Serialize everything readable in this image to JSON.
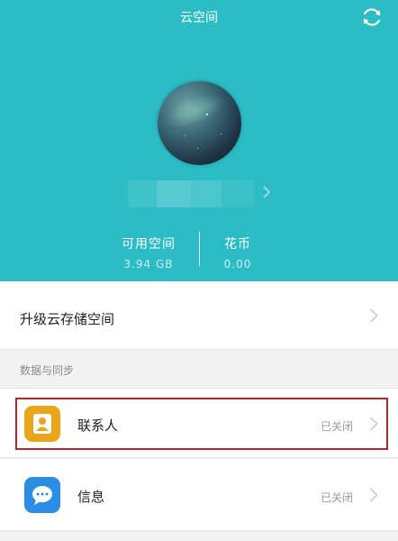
{
  "header": {
    "title": "云空间",
    "refresh_icon": "refresh-icon",
    "background_color": "#2bbcc5"
  },
  "account": {
    "avatar_icon": "avatar-image",
    "chevron_icon": "chevron-right-icon"
  },
  "stats": {
    "space_label": "可用空间",
    "space_value": "3.94 GB",
    "coins_label": "花币",
    "coins_value": "0.00"
  },
  "upgrade": {
    "label": "升级云存储空间",
    "chevron_icon": "chevron-right-icon"
  },
  "section": {
    "title": "数据与同步"
  },
  "items": [
    {
      "label": "联系人",
      "status": "已关闭",
      "icon": "contact-icon",
      "icon_color": "#e9a61b"
    },
    {
      "label": "信息",
      "status": "已关闭",
      "icon": "message-icon",
      "icon_color": "#2a8fe4"
    }
  ],
  "colors": {
    "accent": "#2bbcc5",
    "highlight_border": "#c0242b"
  }
}
